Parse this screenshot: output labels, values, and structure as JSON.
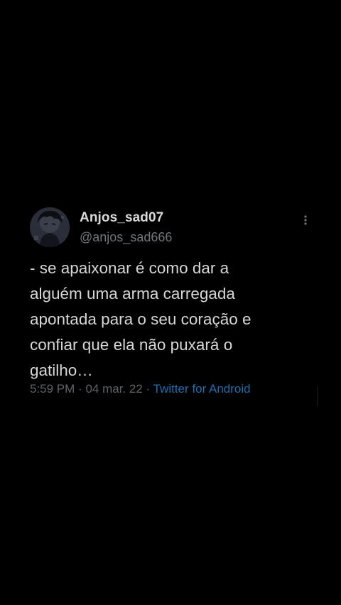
{
  "tweet": {
    "display_name": "Anjos_sad07",
    "handle": "@anjos_sad666",
    "text": "- se apaixonar é como dar a\nalguém uma arma carregada\napontada para o seu coração e\nconfiar que ela não puxará o\ngatilho…",
    "time": "5:59 PM",
    "date": "04 mar. 22",
    "source": "Twitter for Android",
    "separator": "·"
  },
  "icons": {
    "avatar": "anime-avatar",
    "more": "more-vertical-icon"
  },
  "colors": {
    "background": "#000000",
    "name": "#d9d9d9",
    "secondary": "#71767b",
    "source_link": "#1d6fae"
  }
}
